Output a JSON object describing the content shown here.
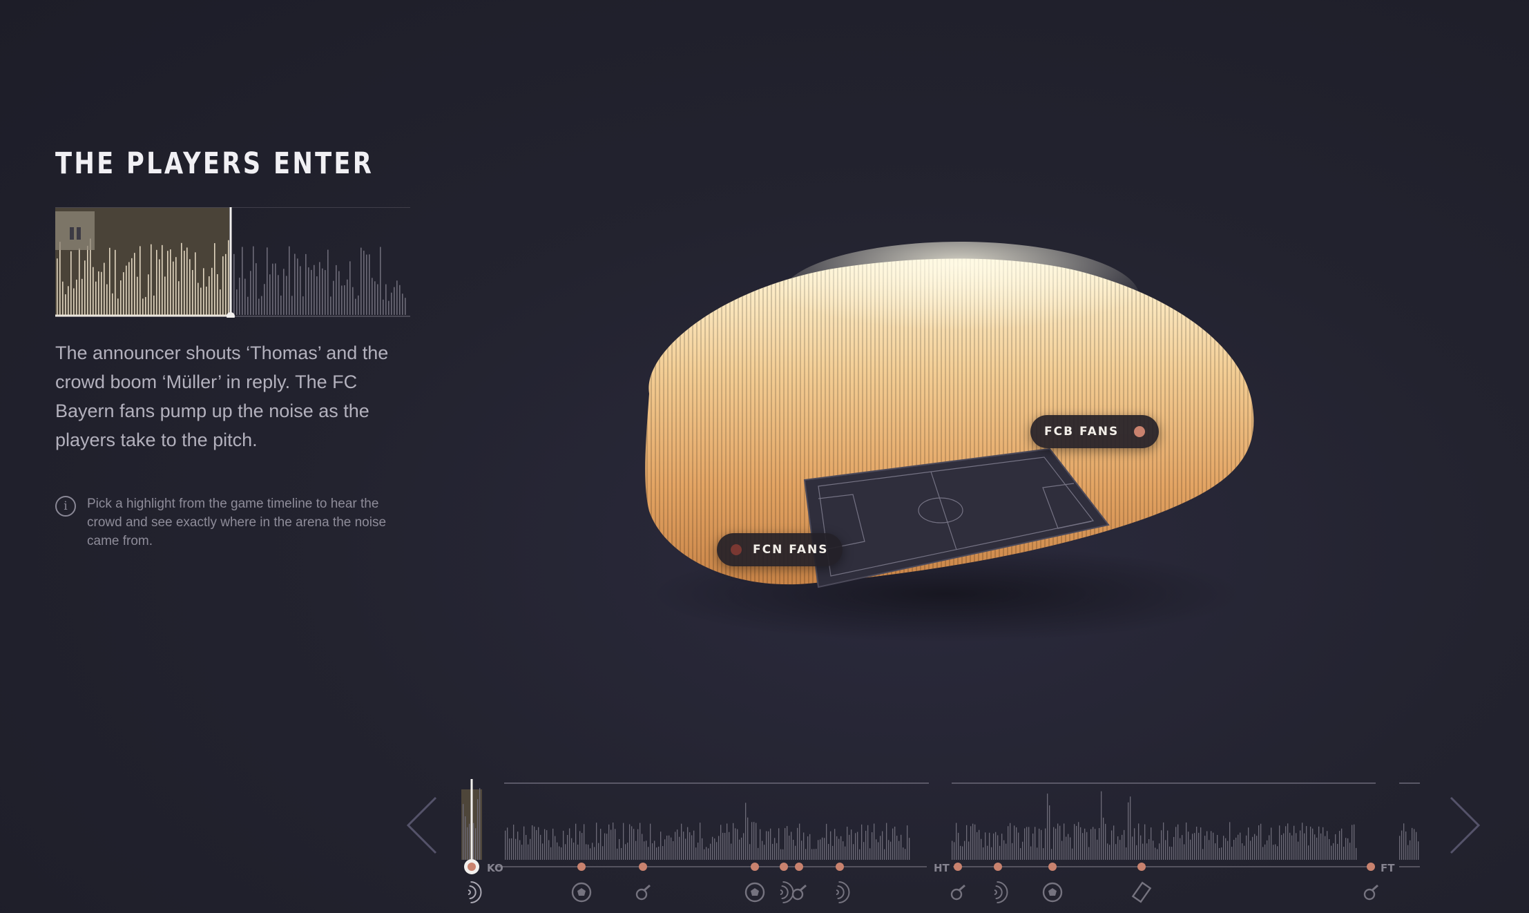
{
  "story": {
    "title": "THE PLAYERS ENTER",
    "paragraph": "The announcer shouts ‘Thomas’ and the crowd boom ‘Müller’ in reply. The FC Bayern fans pump up the noise as the players take to the pitch.",
    "info_text": "Pick a highlight from the game timeline to hear the crowd and see exactly where in the arena the noise came from.",
    "info_icon": "i"
  },
  "player": {
    "progress": 0.49,
    "state_icon": "pause-icon"
  },
  "stadium": {
    "fcb_label": "FCB FANS",
    "fcn_label": "FCN FANS"
  },
  "timeline": {
    "labels": {
      "kickoff": "KO",
      "halftime": "HT",
      "fulltime": "FT"
    },
    "events": [
      {
        "icon": "sound-wave-icon",
        "active": true
      },
      {
        "icon": "ball-icon"
      },
      {
        "icon": "whistle-icon"
      },
      {
        "icon": "ball-icon"
      },
      {
        "icon": "sound-wave-icon"
      },
      {
        "icon": "whistle-icon"
      },
      {
        "icon": "sound-wave-icon"
      },
      {
        "icon": "whistle-icon"
      },
      {
        "icon": "sound-wave-icon"
      },
      {
        "icon": "ball-icon"
      },
      {
        "icon": "card-icon"
      },
      {
        "icon": "whistle-icon"
      }
    ]
  },
  "colors": {
    "background": "#23232f",
    "crowd_light": "#fff2cf",
    "crowd_dark": "#d48f4e",
    "event_dot": "#c9826e",
    "waveform_played": "#e2d6c0",
    "waveform_unplayed": "#6d6b78"
  }
}
